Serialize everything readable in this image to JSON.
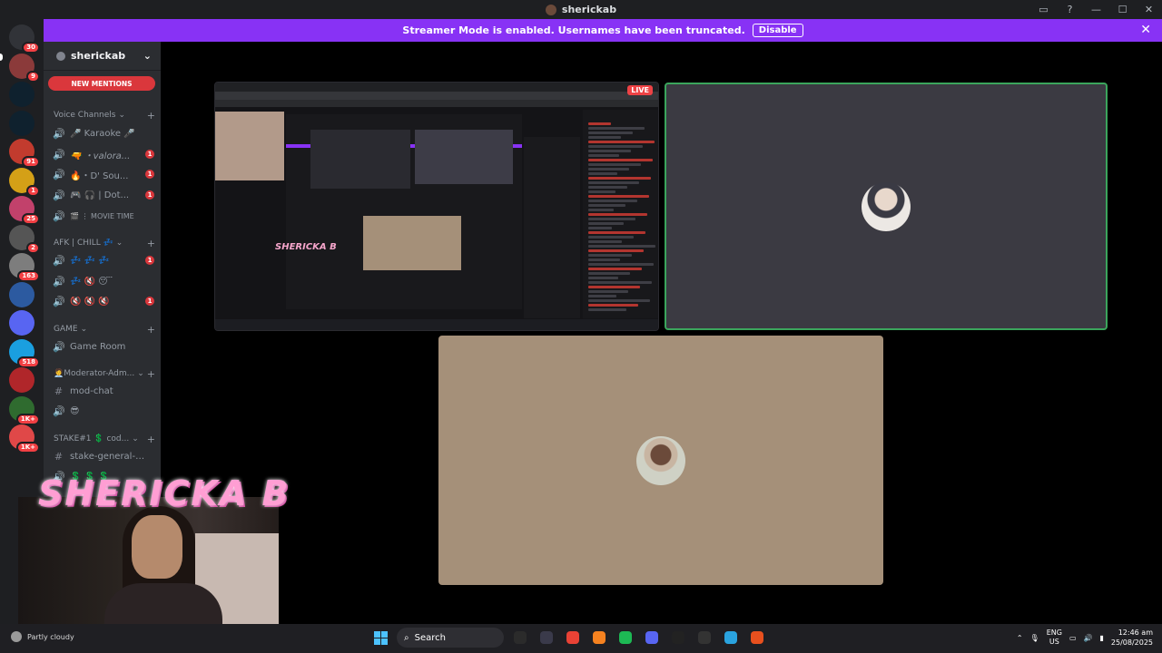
{
  "window": {
    "title": "sherickab",
    "buttons": {
      "inbox": "▭",
      "help": "?",
      "minimize": "—",
      "maximize": "☐",
      "close": "✕"
    }
  },
  "banner": {
    "text": "Streamer Mode is enabled. Usernames have been truncated.",
    "disable_label": "Disable",
    "close_glyph": "✕"
  },
  "server_rail": {
    "items": [
      {
        "name": "discord-home",
        "badge": "30",
        "color": "#313338"
      },
      {
        "name": "server-1",
        "badge": "9",
        "color": "#8b3a3a"
      },
      {
        "name": "stake",
        "badge": "",
        "color": "#0f212e"
      },
      {
        "name": "stake-2",
        "badge": "",
        "color": "#0f212e"
      },
      {
        "name": "server-5",
        "badge": "91",
        "color": "#c23b2e"
      },
      {
        "name": "server-6",
        "badge": "1",
        "color": "#d4a017"
      },
      {
        "name": "server-7",
        "badge": "25",
        "color": "#c2416b"
      },
      {
        "name": "server-8",
        "badge": "2",
        "color": "#555"
      },
      {
        "name": "server-9",
        "badge": "163",
        "color": "#7d7d7d"
      },
      {
        "name": "server-10",
        "badge": "",
        "color": "#2c5aa0"
      },
      {
        "name": "folder",
        "badge": "",
        "color": "#5865f2"
      },
      {
        "name": "server-12",
        "badge": "518",
        "color": "#1a9fe0"
      },
      {
        "name": "server-13",
        "badge": "",
        "color": "#b0262a"
      },
      {
        "name": "server-14",
        "badge": "1K+",
        "color": "#2f6b2f"
      },
      {
        "name": "server-15",
        "badge": "1K+",
        "color": "#e04848"
      }
    ]
  },
  "sidebar": {
    "server_name": "sherickab",
    "new_mentions": "NEW MENTIONS",
    "categories": [
      {
        "label": "Voice Channels"
      },
      {
        "label": "AFK | CHILL 💤"
      },
      {
        "label": "GAME"
      },
      {
        "label": "🧑‍💼Moderator-Adm..."
      },
      {
        "label": "STAKE#1 💲 cod..."
      }
    ],
    "channels": [
      {
        "glyph": "🔊",
        "name": "🎤 Karaoke 🎤",
        "badge": ""
      },
      {
        "glyph": "🔊",
        "name": "🔫 ・valora...",
        "badge": "1",
        "italic": true
      },
      {
        "glyph": "🔊",
        "name": "🔥・D' Sou...",
        "badge": "1"
      },
      {
        "glyph": "🔊",
        "name": "🎮 🎧 | Dot...",
        "badge": "1"
      },
      {
        "glyph": "🔊",
        "name": "🎬 ⋮ MOVIE TIME",
        "badge": ""
      },
      {
        "glyph": "🔊",
        "name": "💤 💤 💤",
        "badge": "1"
      },
      {
        "glyph": "🔊",
        "name": "💤 🔇 😴",
        "badge": ""
      },
      {
        "glyph": "🔊",
        "name": "🔇 🔇 🔇",
        "badge": "1"
      },
      {
        "glyph": "🔊",
        "name": "Game Room",
        "badge": ""
      },
      {
        "glyph": "#",
        "name": "mod-chat",
        "badge": ""
      },
      {
        "glyph": "🔊",
        "name": "😎",
        "badge": ""
      },
      {
        "glyph": "#",
        "name": "stake-general-c...",
        "badge": ""
      },
      {
        "glyph": "🔊",
        "name": "💲 💲 💲",
        "badge": ""
      }
    ]
  },
  "stage": {
    "screen_share": {
      "live_label": "LIVE",
      "overlay_logo": "SHERICKA B"
    },
    "tiles": [
      {
        "kind": "avatar",
        "speaking": true
      },
      {
        "kind": "avatar",
        "speaking": false
      }
    ]
  },
  "stream_overlay": {
    "name": "SHERICKA B"
  },
  "taskbar": {
    "weather": "Partly cloudy",
    "search_label": "Search",
    "lang_top": "ENG",
    "lang_bottom": "US",
    "time": "12:46 am",
    "date": "25/08/2025",
    "apps": [
      "file-explorer",
      "media-app",
      "chrome",
      "affinity",
      "spotify",
      "discord",
      "tf-app",
      "game-app",
      "telegram",
      "streaming-app"
    ]
  },
  "colors": {
    "accent": "#8832f5",
    "danger": "#da373c",
    "speaking": "#3ba55c",
    "overlay_pink": "#ff9ed3"
  }
}
